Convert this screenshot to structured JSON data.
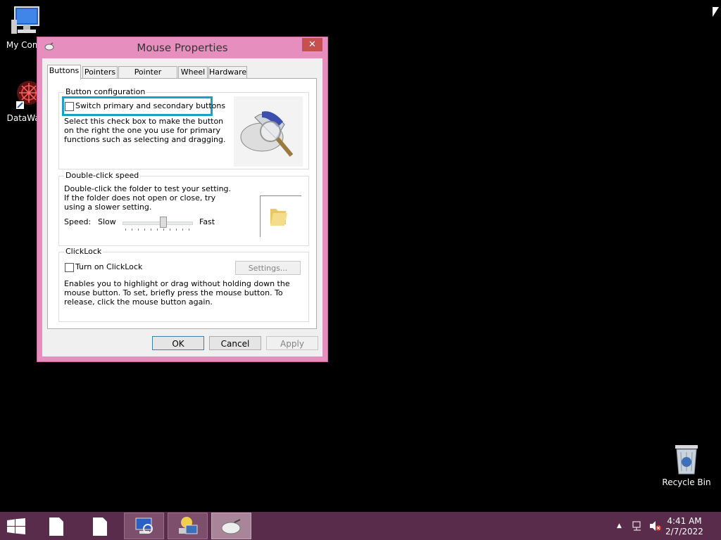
{
  "desktop": {
    "icons": [
      {
        "label": "My Comp"
      },
      {
        "label": "DataWag"
      },
      {
        "label": "Recycle Bin"
      }
    ]
  },
  "dialog": {
    "title": "Mouse Properties",
    "close_label": "✕",
    "tabs": [
      {
        "label": "Buttons",
        "active": true
      },
      {
        "label": "Pointers"
      },
      {
        "label": "Pointer Options"
      },
      {
        "label": "Wheel"
      },
      {
        "label": "Hardware"
      }
    ],
    "button_config": {
      "group_label": "Button configuration",
      "checkbox_label": "Switch primary and secondary buttons",
      "checked": false,
      "description": "Select this check box to make the button on the right the one you use for primary functions such as selecting and dragging."
    },
    "double_click": {
      "group_label": "Double-click speed",
      "description": "Double-click the folder to test your setting. If the folder does not open or close, try using a slower setting.",
      "speed_label": "Speed:",
      "slow_label": "Slow",
      "fast_label": "Fast",
      "speed_level": 0.6
    },
    "clicklock": {
      "group_label": "ClickLock",
      "checkbox_label": "Turn on ClickLock",
      "checked": false,
      "settings_label": "Settings...",
      "description": "Enables you to highlight or drag without holding down the mouse button. To set, briefly press the mouse button. To release, click the mouse button again."
    },
    "buttons": {
      "ok": "OK",
      "cancel": "Cancel",
      "apply": "Apply"
    }
  },
  "taskbar": {
    "time": "4:41 AM",
    "date": "2/7/2022",
    "colors": {
      "taskbar": "#5a2c4b",
      "window_frame": "#e68fbf",
      "highlight": "#1ba0c8"
    }
  }
}
